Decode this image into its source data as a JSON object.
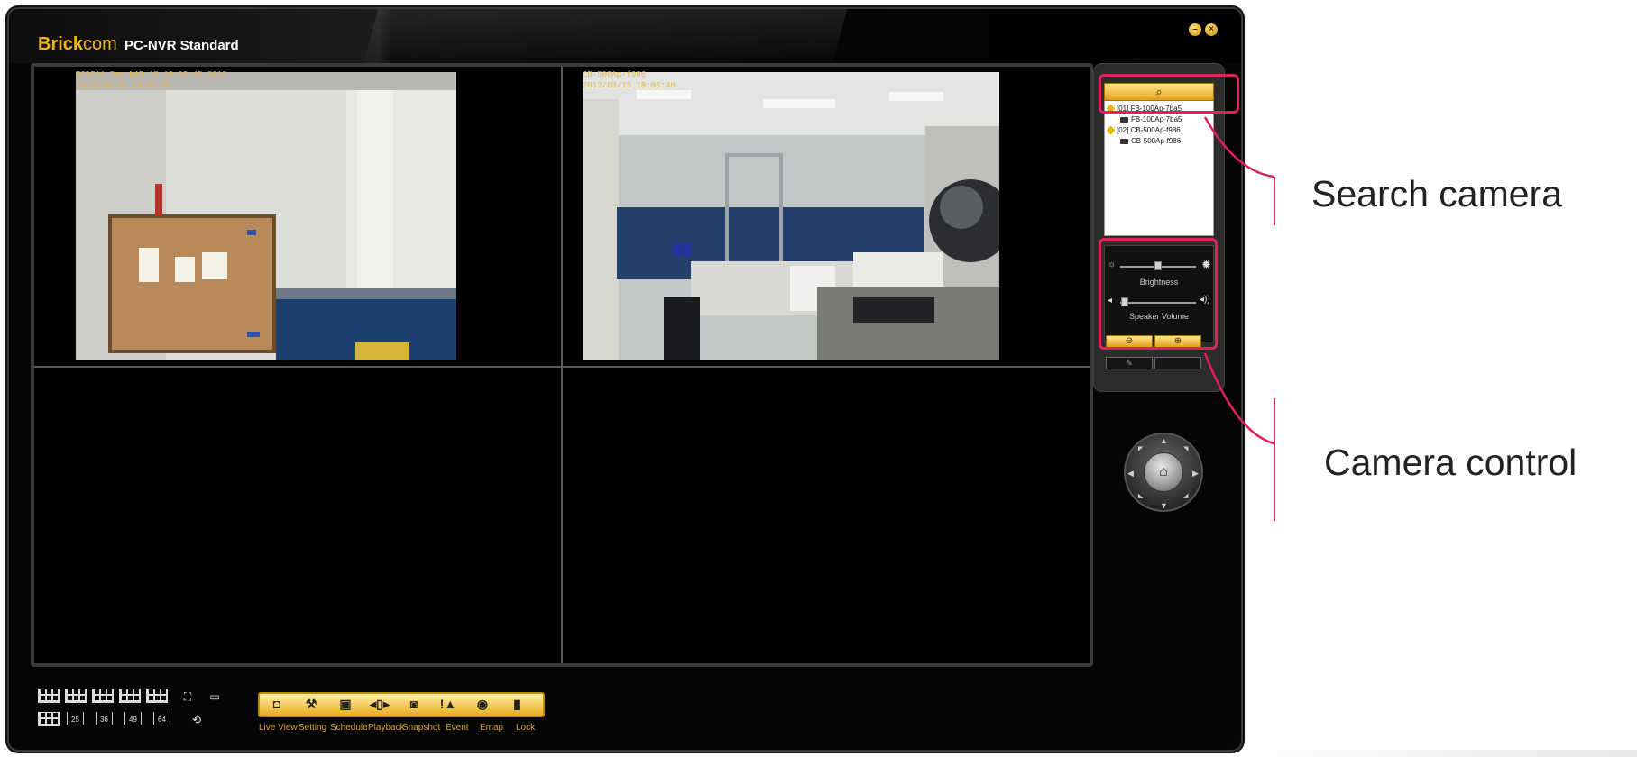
{
  "app": {
    "brand_main": "Brick",
    "brand_suffix": "com",
    "product": "PC-NVR Standard"
  },
  "video": {
    "cam1": {
      "osd_line1": "EGDE11 5ev NAR 15 18:05:45 2012",
      "osd_line2": "2012/03/15 18:05:45"
    },
    "cam2": {
      "osd_line1": "CB-500Ap-f986",
      "osd_line2": "2012/03/15 18:05:46"
    }
  },
  "camera_tree": [
    {
      "label": "[01] FB-100Ap-7ba5",
      "type": "group"
    },
    {
      "label": "FB-100Ap-7ba5",
      "type": "camera"
    },
    {
      "label": "[02] CB-500Ap-f986",
      "type": "group"
    },
    {
      "label": "CB-500Ap-f986",
      "type": "camera"
    }
  ],
  "controls": {
    "brightness_label": "Brightness",
    "speaker_label": "Speaker Volume",
    "brightness_level": 0.5,
    "speaker_level": 0.05
  },
  "toolbar": {
    "buttons": [
      {
        "label": "Live View",
        "icon": "live-view-icon",
        "glyph": "◘"
      },
      {
        "label": "Setting",
        "icon": "wrench-icon",
        "glyph": "⚒"
      },
      {
        "label": "Schedule",
        "icon": "schedule-icon",
        "glyph": "▣"
      },
      {
        "label": "Playback",
        "icon": "playback-icon",
        "glyph": "◂▯▸"
      },
      {
        "label": "Snapshot",
        "icon": "snapshot-icon",
        "glyph": "◙"
      },
      {
        "label": "Event",
        "icon": "event-icon",
        "glyph": "!▲"
      },
      {
        "label": "Emap",
        "icon": "globe-icon",
        "glyph": "◉"
      },
      {
        "label": "Lock",
        "icon": "lock-icon",
        "glyph": "▮"
      }
    ],
    "layout_numbers": [
      "25",
      "36",
      "49",
      "64"
    ]
  },
  "annotations": {
    "search": "Search camera",
    "control": "Camera control"
  },
  "colors": {
    "accent": "#f3b21a",
    "annotation": "#e0205b",
    "window_bg": "#050505"
  }
}
